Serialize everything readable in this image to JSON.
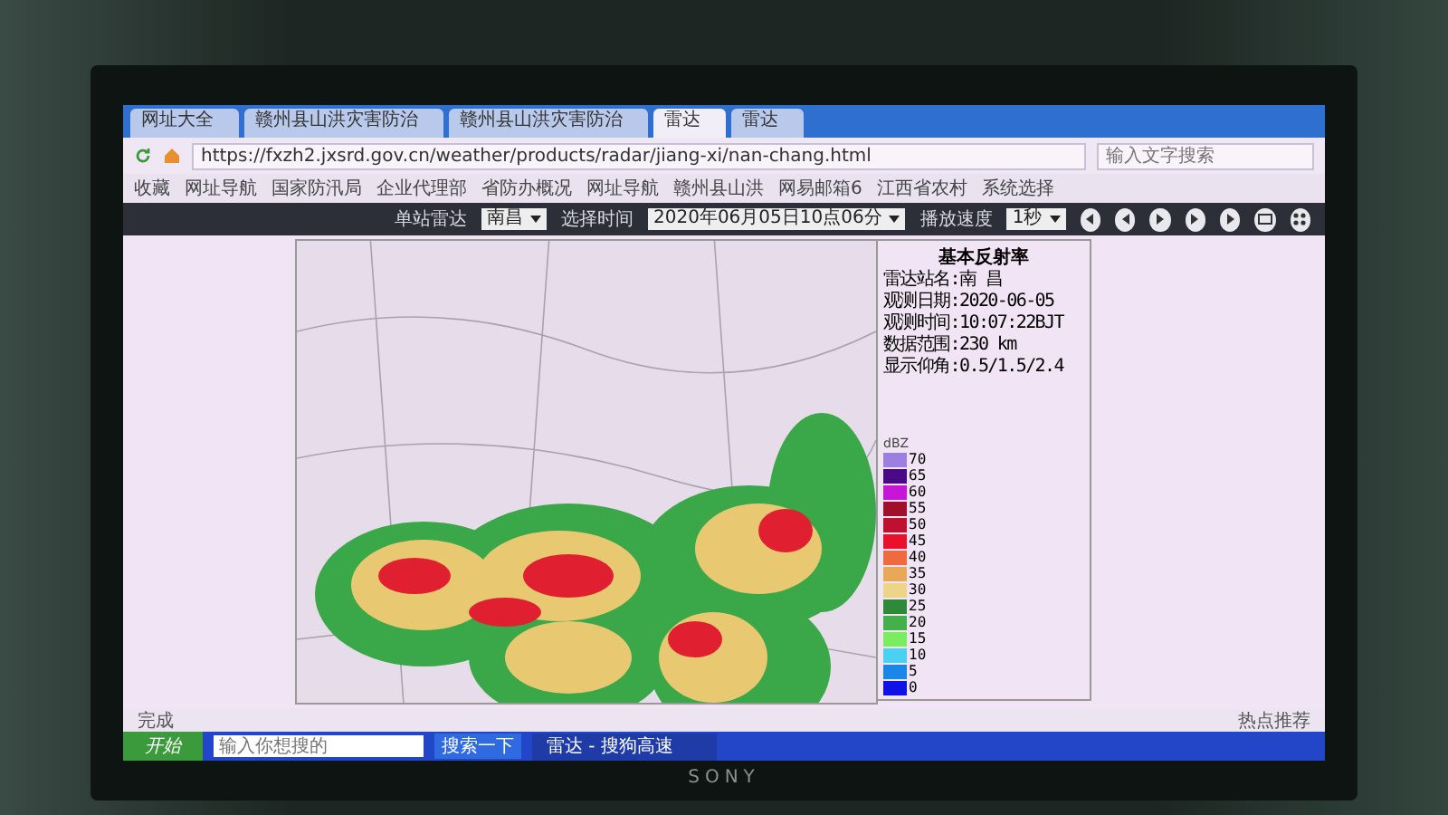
{
  "tabs": [
    {
      "label": "网址大全",
      "selected": false
    },
    {
      "label": "赣州县山洪灾害防治",
      "selected": false
    },
    {
      "label": "赣州县山洪灾害防治",
      "selected": false
    },
    {
      "label": "雷达",
      "selected": true
    },
    {
      "label": "雷达",
      "selected": false
    }
  ],
  "address": {
    "value": "https://fxzh2.jxsrd.gov.cn/weather/products/radar/jiang-xi/nan-chang.html",
    "placeholder": "输入文字搜索"
  },
  "bookmarks": [
    "收藏",
    "网址导航",
    "国家防汛局",
    "企业代理部",
    "省防办概况",
    "网址导航",
    "赣州县山洪",
    "网易邮箱6",
    "江西省农村",
    "系统选择"
  ],
  "controls": [
    {
      "label": "单站雷达",
      "value": "南昌"
    },
    {
      "label": "选择时间",
      "value": "2020年06月05日10点06分"
    },
    {
      "label": "播放速度",
      "value": "1秒"
    }
  ],
  "info": {
    "title": "基本反射率",
    "lines": [
      "雷达站名:南 昌",
      "观测日期:2020-06-05",
      "观测时间:10:07:22BJT",
      "数据范围:230 km",
      "显示仰角:0.5/1.5/2.4"
    ]
  },
  "legend": {
    "unit": "dBZ",
    "items": [
      {
        "label": "70",
        "color": "#9c7fe0"
      },
      {
        "label": "65",
        "color": "#4a0a86"
      },
      {
        "label": "60",
        "color": "#c814d6"
      },
      {
        "label": "55",
        "color": "#a0102a"
      },
      {
        "label": "50",
        "color": "#c01030"
      },
      {
        "label": "45",
        "color": "#e8102a"
      },
      {
        "label": "40",
        "color": "#f06a40"
      },
      {
        "label": "35",
        "color": "#e8a858"
      },
      {
        "label": "30",
        "color": "#eed488"
      },
      {
        "label": "25",
        "color": "#2e8a38"
      },
      {
        "label": "20",
        "color": "#44b04c"
      },
      {
        "label": "15",
        "color": "#7aec60"
      },
      {
        "label": "10",
        "color": "#4ad0f0"
      },
      {
        "label": "5",
        "color": "#1a86e8"
      },
      {
        "label": "0",
        "color": "#1010e8"
      }
    ]
  },
  "status_bar": {
    "left": "完成",
    "right": "热点推荐"
  },
  "taskbar": {
    "start": "开始",
    "search_placeholder": "输入你想搜的",
    "search_button": "搜索一下",
    "window": "雷达 - 搜狗高速"
  },
  "monitor": {
    "brand": "SONY"
  }
}
